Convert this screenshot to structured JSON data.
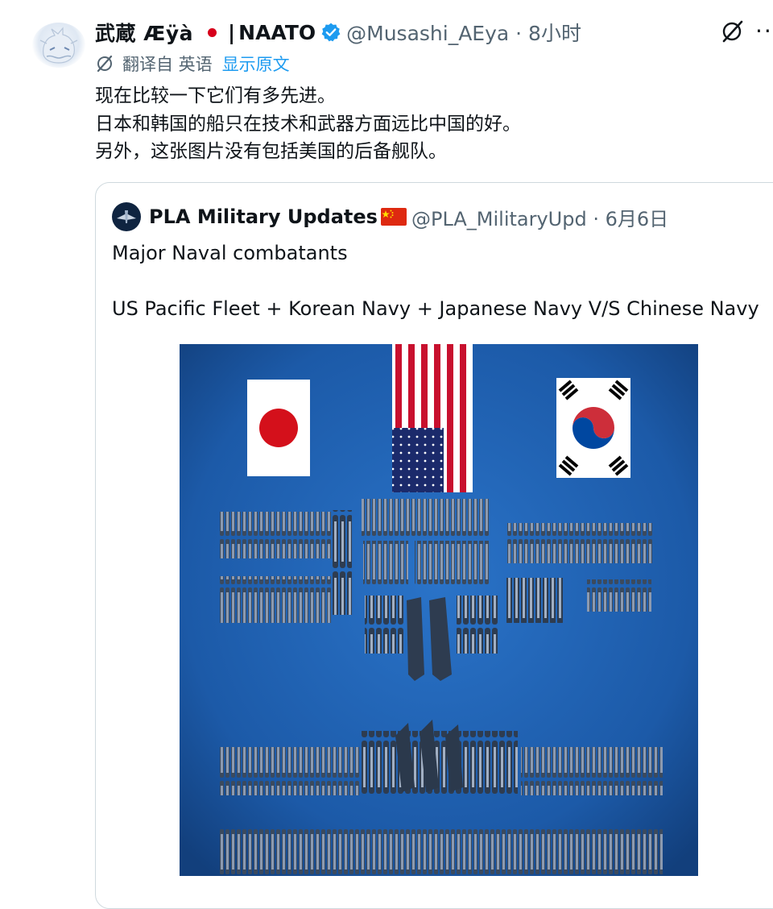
{
  "author": {
    "display_name": "武蔵 Æÿà",
    "separator": "|",
    "org": "NAATO",
    "handle_time": "@Musashi_AEya · 8小时"
  },
  "translation": {
    "label": "翻译自 英语",
    "show_original": "显示原文"
  },
  "tweet_lines": [
    "现在比较一下它们有多先进。",
    "日本和韩国的船只在技术和武器方面远比中国的好。",
    "另外，这张图片没有包括美国的后备舰队。"
  ],
  "quote": {
    "name": "PLA Military Updates",
    "handle_time": "@PLA_MilitaryUpd · 6月6日",
    "line1": "Major Naval combatants",
    "line2": "US Pacific Fleet + Korean Navy + Japanese Navy V/S Chinese Navy"
  },
  "colors": {
    "text": "#0f1419",
    "secondary": "#536471",
    "link": "#1d9bf0",
    "verified": "#1d9bf0",
    "image_background": "#1c5aa8"
  },
  "icons": [
    "user-avatar",
    "red-dot-emoji",
    "verified-badge-icon",
    "grok-icon",
    "more-options-icon",
    "translate-icon",
    "china-flag-emoji"
  ],
  "media_description_icons": [
    "japan-flag",
    "us-flag",
    "south-korea-flag",
    "warship-silhouettes"
  ]
}
